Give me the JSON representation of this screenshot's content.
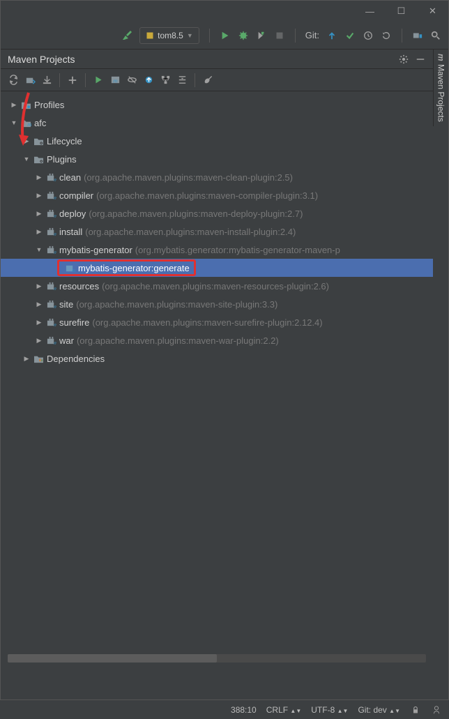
{
  "window_controls": {
    "minimize": "—",
    "maximize": "☐",
    "close": "✕"
  },
  "main_toolbar": {
    "hammer_icon": "hammer",
    "run_config": "tom8.5",
    "git_label": "Git:"
  },
  "panel": {
    "title": "Maven Projects",
    "side_tab": "Maven Projects"
  },
  "tree": {
    "profiles": "Profiles",
    "project": "afc",
    "lifecycle": "Lifecycle",
    "plugins": "Plugins",
    "dependencies": "Dependencies",
    "plugin_items": [
      {
        "name": "clean",
        "detail": "(org.apache.maven.plugins:maven-clean-plugin:2.5)",
        "expanded": false
      },
      {
        "name": "compiler",
        "detail": "(org.apache.maven.plugins:maven-compiler-plugin:3.1)",
        "expanded": false
      },
      {
        "name": "deploy",
        "detail": "(org.apache.maven.plugins:maven-deploy-plugin:2.7)",
        "expanded": false
      },
      {
        "name": "install",
        "detail": "(org.apache.maven.plugins:maven-install-plugin:2.4)",
        "expanded": false
      },
      {
        "name": "mybatis-generator",
        "detail": "(org.mybatis.generator:mybatis-generator-maven-p",
        "expanded": true
      },
      {
        "name": "resources",
        "detail": "(org.apache.maven.plugins:maven-resources-plugin:2.6)",
        "expanded": false
      },
      {
        "name": "site",
        "detail": "(org.apache.maven.plugins:maven-site-plugin:3.3)",
        "expanded": false
      },
      {
        "name": "surefire",
        "detail": "(org.apache.maven.plugins:maven-surefire-plugin:2.12.4)",
        "expanded": false
      },
      {
        "name": "war",
        "detail": "(org.apache.maven.plugins:maven-war-plugin:2.2)",
        "expanded": false
      }
    ],
    "selected_goal": "mybatis-generator:generate"
  },
  "status_bar": {
    "position": "388:10",
    "line_ending": "CRLF",
    "encoding": "UTF-8",
    "git_branch": "Git: dev"
  },
  "colors": {
    "accent": "#4b6eaf",
    "highlight": "#e03030"
  }
}
